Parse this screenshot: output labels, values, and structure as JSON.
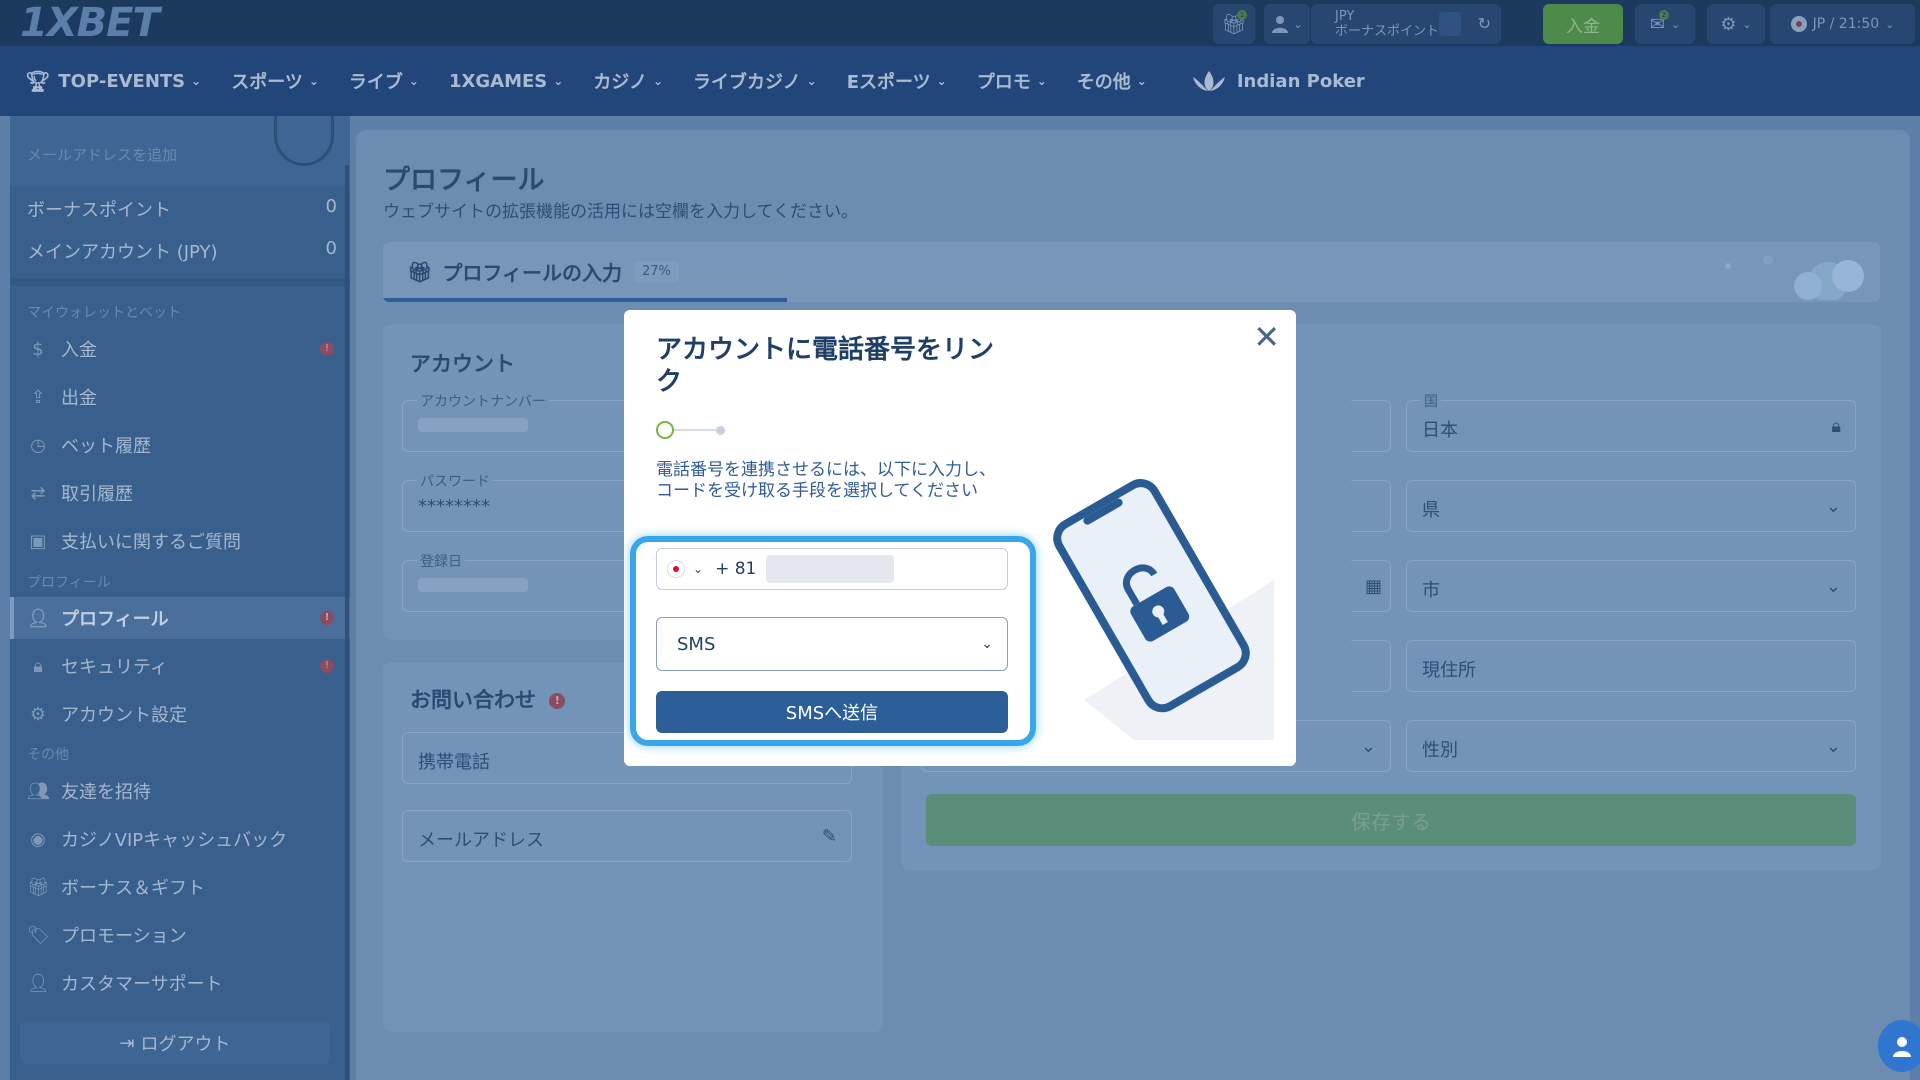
{
  "header": {
    "logo": "1XBET",
    "gift_badge": "1",
    "balance_currency": "JPY",
    "balance_label": "ボーナスポイント",
    "deposit_label": "入金",
    "mail_badge": "2",
    "lang_time": "JP / 21:50"
  },
  "nav": {
    "items": [
      {
        "label": "TOP-EVENTS",
        "icon": "trophy-icon"
      },
      {
        "label": "スポーツ"
      },
      {
        "label": "ライブ"
      },
      {
        "label": "1XGAMES"
      },
      {
        "label": "カジノ"
      },
      {
        "label": "ライブカジノ"
      },
      {
        "label": "Eスポーツ"
      },
      {
        "label": "プロモ"
      },
      {
        "label": "その他"
      },
      {
        "label": "Indian Poker",
        "icon": "lotus-icon"
      }
    ]
  },
  "sidebar": {
    "email_label": "メールアドレスを追加",
    "bonus_points_label": "ボーナスポイント",
    "bonus_points_value": "0",
    "main_account_label": "メインアカウント (JPY)",
    "main_account_value": "0",
    "wallet_section": "マイウォレットとベット",
    "wallet_items": [
      {
        "label": "入金",
        "icon": "dollar-icon",
        "alert": true
      },
      {
        "label": "出金",
        "icon": "upload-icon"
      },
      {
        "label": "ベット履歴",
        "icon": "clock-icon"
      },
      {
        "label": "取引履歴",
        "icon": "transfer-icon"
      },
      {
        "label": "支払いに関するご質問",
        "icon": "payment-question-icon"
      }
    ],
    "profile_section": "プロフィール",
    "profile_items": [
      {
        "label": "プロフィール",
        "icon": "user-icon",
        "alert": true,
        "active": true
      },
      {
        "label": "セキュリティ",
        "icon": "lock-icon",
        "alert": true
      },
      {
        "label": "アカウント設定",
        "icon": "gear-icon"
      }
    ],
    "other_section": "その他",
    "other_items": [
      {
        "label": "友達を招待",
        "icon": "users-icon"
      },
      {
        "label": "カジノVIPキャッシュバック",
        "icon": "chip-icon"
      },
      {
        "label": "ボーナス＆ギフト",
        "icon": "gift-icon"
      },
      {
        "label": "プロモーション",
        "icon": "tag-icon"
      },
      {
        "label": "カスタマーサポート",
        "icon": "support-icon"
      }
    ],
    "logout_label": "ログアウト"
  },
  "main": {
    "title": "プロフィール",
    "subtitle": "ウェブサイトの拡張機能の活用には空欄を入力してください。",
    "progress_label": "プロフィールの入力",
    "progress_pct": "27%",
    "progress_value": 0.27,
    "account_title": "アカウント",
    "account_number_label": "アカウントナンバー",
    "password_label": "パスワード",
    "password_value": "********",
    "reg_date_label": "登録日",
    "contact_title": "お問い合わせ",
    "mobile_label": "携帯電話",
    "email_field_label": "メールアドレス",
    "country_label": "国",
    "country_value": "日本",
    "prefecture_placeholder": "県",
    "city_placeholder": "市",
    "address_placeholder": "現住所",
    "gender_placeholder": "性別",
    "save_label": "保存する"
  },
  "modal": {
    "title": "アカウントに電話番号をリンク",
    "description": "電話番号を連携させるには、以下に入力し、コードを受け取る手段を選択してください",
    "country_code": "+ 81",
    "method_value": "SMS",
    "send_label": "SMSへ送信",
    "close_glyph": "✕"
  },
  "colors": {
    "modal_button": "#2c5f98",
    "highlight_border": "#37a6ea",
    "deposit_green": "#4c8b4a"
  }
}
